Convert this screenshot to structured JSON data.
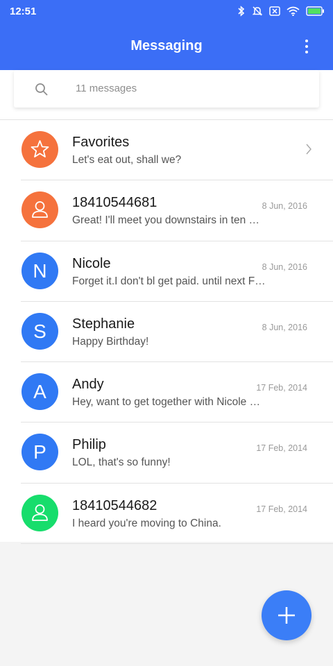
{
  "status_bar": {
    "time": "12:51",
    "icons": [
      "bluetooth-icon",
      "mute-icon",
      "sim-icon",
      "wifi-icon",
      "battery-icon"
    ]
  },
  "header": {
    "title": "Messaging",
    "menu_icon": "more-vert-icon"
  },
  "search": {
    "placeholder": "11 messages"
  },
  "colors": {
    "accent": "#3b6ef6",
    "orange": "#f5723d",
    "blue": "#3079f4",
    "green": "#17dd6c"
  },
  "conversations": [
    {
      "name": "Favorites",
      "snippet": "Let's eat out, shall we?",
      "date": "",
      "avatar": "star-icon",
      "avatar_color": "#f5723d"
    },
    {
      "name": "18410544681",
      "snippet": "Great! I'll meet you downstairs in ten …",
      "date": "8 Jun, 2016",
      "avatar": "person-icon",
      "avatar_color": "#f5723d"
    },
    {
      "name": "Nicole",
      "snippet": "Forget it.I don't bl get paid. until next F…",
      "date": "8 Jun, 2016",
      "avatar": "N",
      "avatar_color": "#3079f4"
    },
    {
      "name": "Stephanie",
      "snippet": "Happy Birthday!",
      "date": "8 Jun, 2016",
      "avatar": "S",
      "avatar_color": "#3079f4"
    },
    {
      "name": "Andy",
      "snippet": "Hey, want to get together with Nicole …",
      "date": "17 Feb, 2014",
      "avatar": "A",
      "avatar_color": "#3079f4"
    },
    {
      "name": "Philip",
      "snippet": "LOL, that's so funny!",
      "date": "17 Feb, 2014",
      "avatar": "P",
      "avatar_color": "#3079f4"
    },
    {
      "name": "18410544682",
      "snippet": "I heard you're moving to China.",
      "date": "17 Feb, 2014",
      "avatar": "person-icon",
      "avatar_color": "#17dd6c"
    }
  ],
  "fab": {
    "icon": "plus-icon"
  }
}
